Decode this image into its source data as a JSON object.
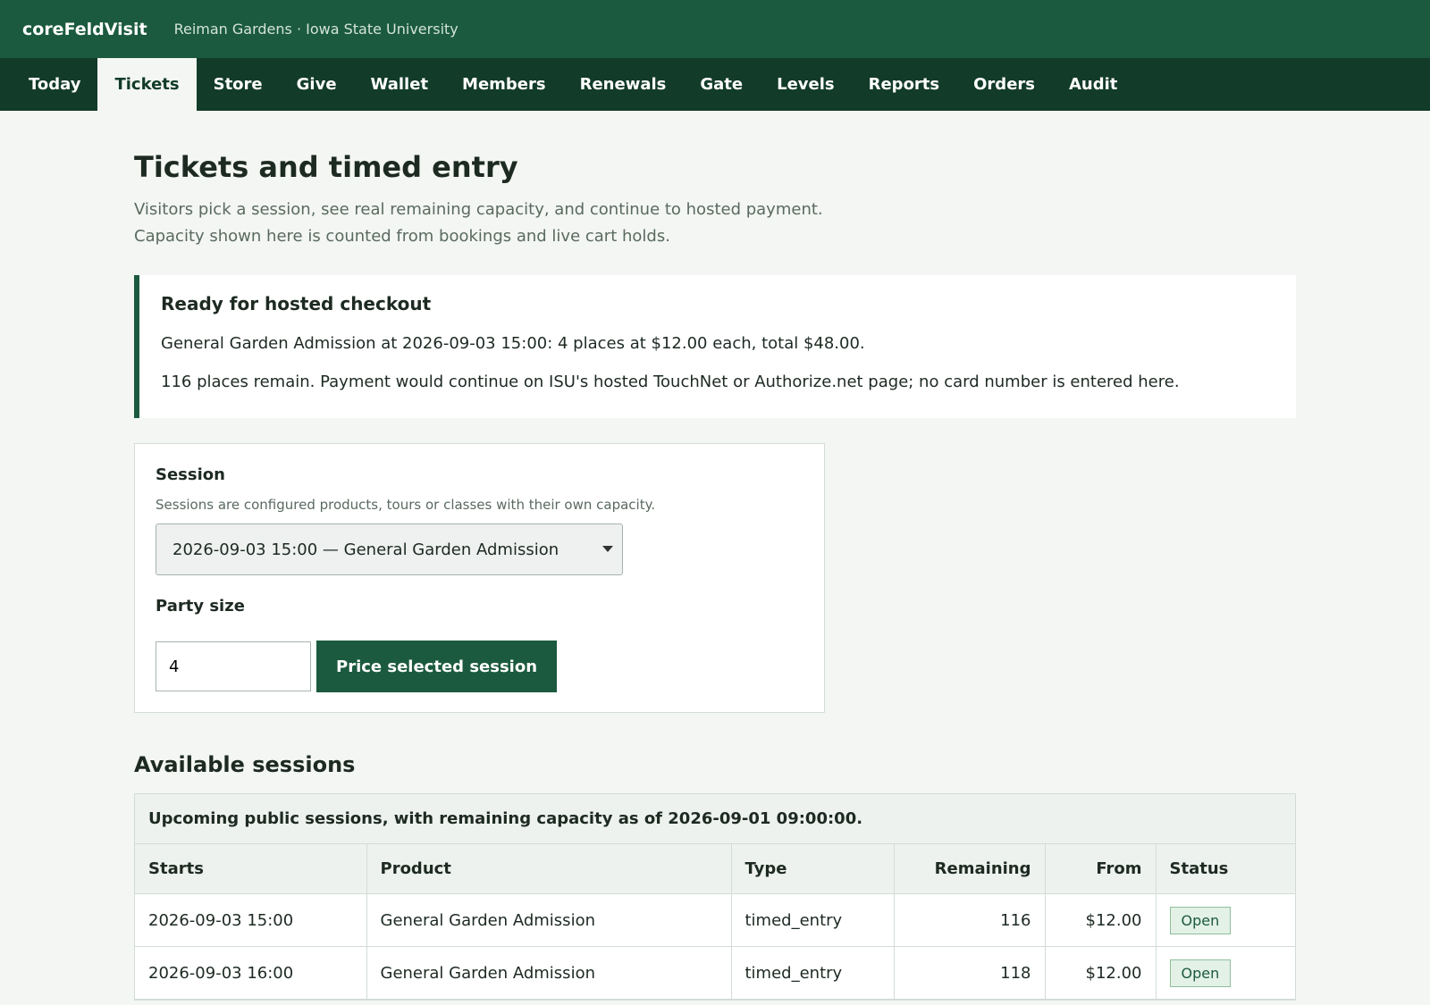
{
  "header": {
    "brand": "coreFeldVisit",
    "org": "Reiman Gardens · Iowa State University"
  },
  "nav": {
    "items": [
      "Today",
      "Tickets",
      "Store",
      "Give",
      "Wallet",
      "Members",
      "Renewals",
      "Gate",
      "Levels",
      "Reports",
      "Orders",
      "Audit"
    ],
    "active": "Tickets"
  },
  "page": {
    "title": "Tickets and timed entry",
    "subtitle_line1": "Visitors pick a session, see real remaining capacity, and continue to hosted payment.",
    "subtitle_line2": "Capacity shown here is counted from bookings and live cart holds."
  },
  "notice": {
    "title": "Ready for hosted checkout",
    "line1": "General Garden Admission at 2026-09-03 15:00: 4 places at $12.00 each, total $48.00.",
    "line2": "116 places remain. Payment would continue on ISU's hosted TouchNet or Authorize.net page; no card number is entered here."
  },
  "form": {
    "session_label": "Session",
    "session_help": "Sessions are configured products, tours or classes with their own capacity.",
    "session_selected": "2026-09-03 15:00 — General Garden Admission",
    "party_label": "Party size",
    "party_value": "4",
    "submit_label": "Price selected session"
  },
  "sessions": {
    "title": "Available sessions",
    "caption": "Upcoming public sessions, with remaining capacity as of 2026-09-01 09:00:00.",
    "columns": [
      "Starts",
      "Product",
      "Type",
      "Remaining",
      "From",
      "Status"
    ],
    "rows": [
      [
        "2026-09-03 15:00",
        "General Garden Admission",
        "timed_entry",
        "116",
        "$12.00",
        "Open"
      ],
      [
        "2026-09-03 16:00",
        "General Garden Admission",
        "timed_entry",
        "118",
        "$12.00",
        "Open"
      ]
    ]
  },
  "colors": {
    "brand": "#1b5a3e",
    "nav": "#123b29",
    "page_bg": "#f3f6f3"
  }
}
